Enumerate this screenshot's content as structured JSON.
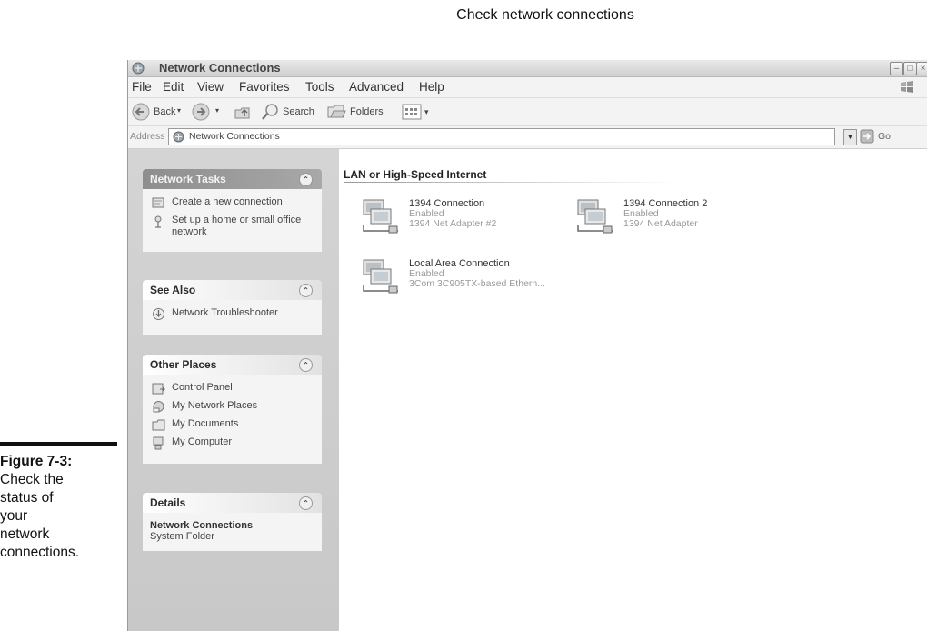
{
  "annotation": {
    "callout": "Check network connections",
    "figure_number": "Figure 7-3:",
    "figure_caption_lines": [
      "Check the",
      "status of",
      "your",
      "network",
      "connections."
    ]
  },
  "window": {
    "title": "Network Connections",
    "menu": [
      "File",
      "Edit",
      "View",
      "Favorites",
      "Tools",
      "Advanced",
      "Help"
    ],
    "toolbar": {
      "back": "Back",
      "search": "Search",
      "folders": "Folders"
    },
    "address": {
      "label": "Address",
      "value": "Network Connections",
      "go": "Go"
    }
  },
  "taskpane": {
    "network_tasks": {
      "title": "Network Tasks",
      "items": [
        "Create a new connection",
        "Set up a home or small office network"
      ]
    },
    "see_also": {
      "title": "See Also",
      "items": [
        "Network Troubleshooter"
      ]
    },
    "other_places": {
      "title": "Other Places",
      "items": [
        "Control Panel",
        "My Network Places",
        "My Documents",
        "My Computer"
      ]
    },
    "details": {
      "title": "Details",
      "name": "Network Connections",
      "type": "System Folder"
    }
  },
  "content": {
    "group_title": "LAN or High-Speed Internet",
    "connections": [
      {
        "name": "1394 Connection",
        "status": "Enabled",
        "device": "1394 Net Adapter #2"
      },
      {
        "name": "1394 Connection 2",
        "status": "Enabled",
        "device": "1394 Net Adapter"
      },
      {
        "name": "Local Area Connection",
        "status": "Enabled",
        "device": "3Com 3C905TX-based Ethern..."
      }
    ]
  }
}
